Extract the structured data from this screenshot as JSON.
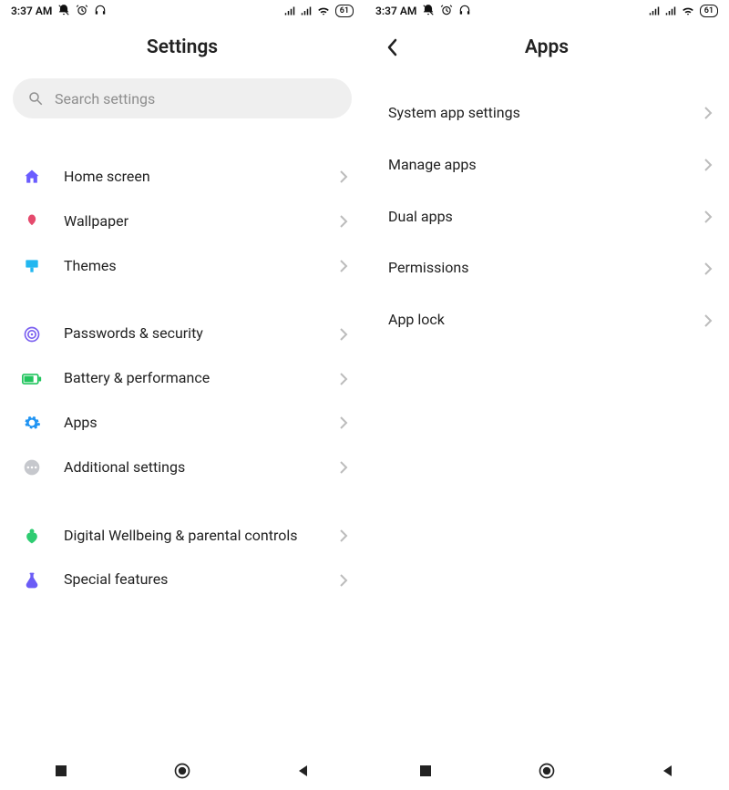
{
  "status": {
    "time": "3:37 AM",
    "battery": "61"
  },
  "left": {
    "header": {
      "title": "Settings"
    },
    "search": {
      "placeholder": "Search settings"
    },
    "items": [
      {
        "label": "Home screen"
      },
      {
        "label": "Wallpaper"
      },
      {
        "label": "Themes"
      },
      {
        "label": "Passwords & security"
      },
      {
        "label": "Battery & performance"
      },
      {
        "label": "Apps"
      },
      {
        "label": "Additional settings"
      },
      {
        "label": "Digital Wellbeing & parental controls"
      },
      {
        "label": "Special features"
      }
    ]
  },
  "right": {
    "header": {
      "title": "Apps"
    },
    "items": [
      {
        "label": "System app settings"
      },
      {
        "label": "Manage apps"
      },
      {
        "label": "Dual apps"
      },
      {
        "label": "Permissions"
      },
      {
        "label": "App lock"
      }
    ]
  }
}
